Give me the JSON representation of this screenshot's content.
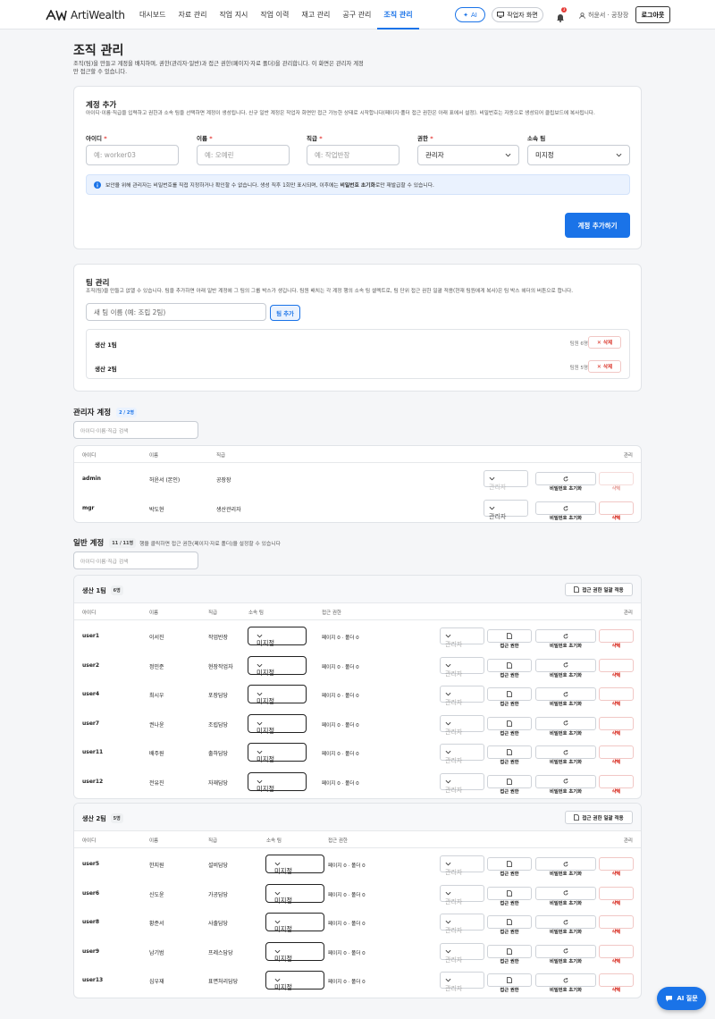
{
  "nav": {
    "logo_text": "ArtiWealth",
    "items": [
      "대시보드",
      "자료 관리",
      "작업 지시",
      "작업 이력",
      "재고 관리",
      "공구 관리",
      "조직 관리"
    ],
    "active_index": 6,
    "ai_label": "AI",
    "worker_screen_label": "작업자 화면",
    "notification_count": "3",
    "user_label": "허윤서 · 공장장",
    "logout_label": "로그아웃"
  },
  "page": {
    "title": "조직 관리",
    "description": "조직(팀)을 만들고 계정을 배치하며, 권한(관리자·일반)과 접근 권한(페이지·자료 폴더)을 관리합니다. 이 화면은 관리자 계정만 접근할 수 있습니다."
  },
  "add_account": {
    "title": "계정 추가",
    "description": "아이디·이름·직급을 입력하고 권한과 소속 팀을 선택하면 계정이 생성됩니다. 신규 일반 계정은 작업자 화면만 접근 가능한 상태로 시작합니다(페이지·폴더 접근 권한은 아래 표에서 설정). 비밀번호는 자동으로 생성되어 클립보드에 복사됩니다.",
    "fields": {
      "id": {
        "label": "아이디",
        "placeholder": "예: worker03"
      },
      "name": {
        "label": "이름",
        "placeholder": "예: 오예린"
      },
      "rank": {
        "label": "직급",
        "placeholder": "예: 작업반장"
      },
      "role": {
        "label": "권한",
        "value": "관리자"
      },
      "team": {
        "label": "소속 팀",
        "value": "미지정"
      }
    },
    "required_mark": "*",
    "info_text_pre": "보안을 위해 관리자는 비밀번호를 직접 지정하거나 확인할 수 없습니다. 생성 직후 1회만 표시되며, 이후에는 ",
    "info_text_bold": "비밀번호 초기화",
    "info_text_post": "로만 재발급할 수 있습니다.",
    "submit_label": "계정 추가하기"
  },
  "team_mgmt": {
    "title": "팀 관리",
    "description": "조직(팀)을 만들고 없앨 수 있습니다. 팀을 추가하면 아래 일반 계정에 그 팀의 그룹 박스가 생깁니다. 팀원 배치는 각 계정 행의 소속 팀 셀렉트로, 팀 단위 접근 권한 일괄 적용(현재 팀원에게 복사)은 팀 박스 헤더의 버튼으로 합니다.",
    "input_placeholder": "새 팀 이름 (예: 조립 2팀)",
    "add_label": "팀 추가",
    "delete_label": "삭제",
    "teams": [
      {
        "name": "생산 1팀",
        "count": "팀원 6명"
      },
      {
        "name": "생산 2팀",
        "count": "팀원 5명"
      }
    ]
  },
  "admins": {
    "title": "관리자 계정",
    "badge": "2 / 2명",
    "search_placeholder": "아이디·이름·직급 검색",
    "headers": {
      "id": "아이디",
      "name": "이름",
      "rank": "직급",
      "actions": "관리"
    },
    "rows": [
      {
        "id": "admin",
        "name": "허윤서 (본인)",
        "rank": "공장장"
      },
      {
        "id": "mgr",
        "name": "박도현",
        "rank": "생산관리자"
      }
    ]
  },
  "general": {
    "title": "일반 계정",
    "badge": "11 / 11명",
    "hint": "행을 클릭하면 접근 권한(페이지·자료 폴더)을 설정할 수 있습니다",
    "search_placeholder": "아이디·이름·직급 검색",
    "headers": {
      "id": "아이디",
      "name": "이름",
      "rank": "직급",
      "team": "소속 팀",
      "access": "접근 권한",
      "actions": "관리"
    },
    "bulk_label": "접근 권한 일괄 적용",
    "groups": [
      {
        "name": "생산 1팀",
        "count": "6명",
        "rows": [
          {
            "id": "user1",
            "name": "이서진",
            "rank": "작업반장",
            "team": "미지정",
            "access": "페이지 0 · 폴더 0"
          },
          {
            "id": "user2",
            "name": "정민준",
            "rank": "현장작업자",
            "team": "미지정",
            "access": "페이지 0 · 폴더 0"
          },
          {
            "id": "user4",
            "name": "최시우",
            "rank": "포장담당",
            "team": "미지정",
            "access": "페이지 0 · 폴더 0"
          },
          {
            "id": "user7",
            "name": "권나윤",
            "rank": "조립담당",
            "team": "미지정",
            "access": "페이지 0 · 폴더 0"
          },
          {
            "id": "user11",
            "name": "배주원",
            "rank": "출하담당",
            "team": "미지정",
            "access": "페이지 0 · 폴더 0"
          },
          {
            "id": "user12",
            "name": "전유진",
            "rank": "자재담당",
            "team": "미지정",
            "access": "페이지 0 · 폴더 0"
          }
        ]
      },
      {
        "name": "생산 2팀",
        "count": "5명",
        "rows": [
          {
            "id": "user5",
            "name": "한지원",
            "rank": "설비담당",
            "team": "미지정",
            "access": "페이지 0 · 폴더 0"
          },
          {
            "id": "user6",
            "name": "신도윤",
            "rank": "가공담당",
            "team": "미지정",
            "access": "페이지 0 · 폴더 0"
          },
          {
            "id": "user8",
            "name": "황준서",
            "rank": "사출담당",
            "team": "미지정",
            "access": "페이지 0 · 폴더 0"
          },
          {
            "id": "user9",
            "name": "남기범",
            "rank": "프레스담당",
            "team": "미지정",
            "access": "페이지 0 · 폴더 0"
          },
          {
            "id": "user13",
            "name": "심우재",
            "rank": "표면처리담당",
            "team": "미지정",
            "access": "페이지 0 · 폴더 0"
          }
        ]
      }
    ]
  },
  "row_actions": {
    "role_value": "관리자",
    "access_label": "접근 권한",
    "reset_label": "비밀번호 초기화",
    "delete_label": "삭제"
  },
  "fab_label": "AI 질문",
  "colors": {
    "accent": "#1a73e8",
    "danger": "#d93025"
  }
}
